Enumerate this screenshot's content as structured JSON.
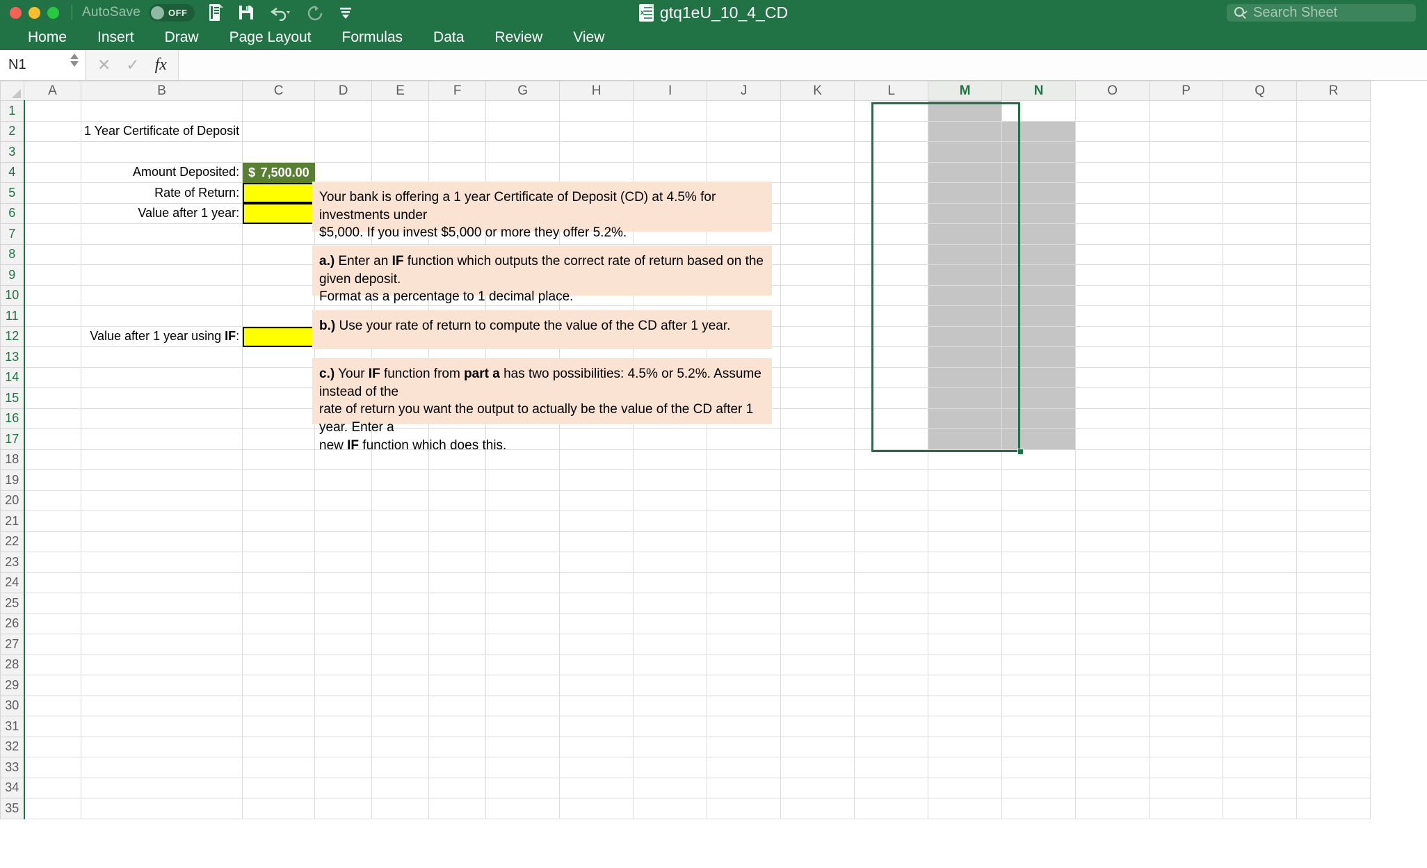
{
  "titlebar": {
    "autosave_label": "AutoSave",
    "autosave_state": "OFF",
    "document_title": "gtq1eU_10_4_CD",
    "search_placeholder": "Search Sheet"
  },
  "ribbon": {
    "tabs": [
      "Home",
      "Insert",
      "Draw",
      "Page Layout",
      "Formulas",
      "Data",
      "Review",
      "View"
    ]
  },
  "formula_bar": {
    "name_box": "N1",
    "formula_value": ""
  },
  "grid": {
    "columns": [
      "A",
      "B",
      "C",
      "D",
      "E",
      "F",
      "G",
      "H",
      "I",
      "J",
      "K",
      "L",
      "M",
      "N",
      "O",
      "P",
      "Q",
      "R"
    ],
    "selected_columns": [
      "M",
      "N"
    ],
    "rows": [
      1,
      2,
      3,
      4,
      5,
      6,
      7,
      8,
      9,
      10,
      11,
      12,
      13,
      14,
      15,
      16,
      17,
      18,
      19,
      20,
      21,
      22,
      23,
      24,
      25,
      26,
      27,
      28,
      29,
      30,
      31,
      32,
      33,
      34,
      35
    ],
    "selection_range": "M1:N17",
    "active_cell": "N1"
  },
  "cells": {
    "b2_title": "1 Year Certificate of Deposit",
    "b4_label": "Amount Deposited:",
    "c4_currency": "$",
    "c4_value": "7,500.00",
    "b5_label": "Rate of Return:",
    "b6_label": "Value after 1 year:",
    "b12_label_prefix": "Value after 1 year using ",
    "b12_label_bold": "IF",
    "b12_label_suffix": ":"
  },
  "instructions": {
    "intro": {
      "line1": "Your bank is offering a 1 year Certificate of Deposit (CD) at 4.5% for investments under",
      "line2": "$5,000.  If you invest $5,000 or more they offer 5.2%."
    },
    "part_a": {
      "marker": "a.)",
      "text_1": "Enter an ",
      "bold_1": "IF",
      "text_2": " function which outputs the correct rate of return based on the given deposit.",
      "text_3": "Format as a percentage to 1 decimal place."
    },
    "part_b": {
      "marker": "b.)",
      "text_1": "Use your rate of return to compute the value of the CD after 1 year."
    },
    "part_c": {
      "marker": "c.)",
      "text_1": "Your ",
      "bold_1": "IF",
      "text_2": " function from ",
      "bold_2": "part a",
      "text_3": " has two possibilities: 4.5% or 5.2%.  Assume instead of the",
      "text_4": "rate of return you want the output to actually be the value of the CD after 1 year.  Enter a",
      "text_5": "new ",
      "bold_3": "IF",
      "text_6": " function which does this."
    }
  },
  "colors": {
    "excel_green": "#217346",
    "instruction_bg": "#fbe3d4",
    "input_yellow": "#ffff00",
    "value_green": "#5a7f33",
    "selection_gray": "#c5c5c5"
  },
  "icons": {
    "new_doc": "new-document-icon",
    "save": "save-icon",
    "undo": "undo-icon",
    "redo": "redo-icon",
    "customize": "customize-toolbar-icon",
    "cancel": "cancel-entry-icon",
    "confirm": "confirm-entry-icon",
    "function": "insert-function-icon",
    "search": "search-icon"
  }
}
